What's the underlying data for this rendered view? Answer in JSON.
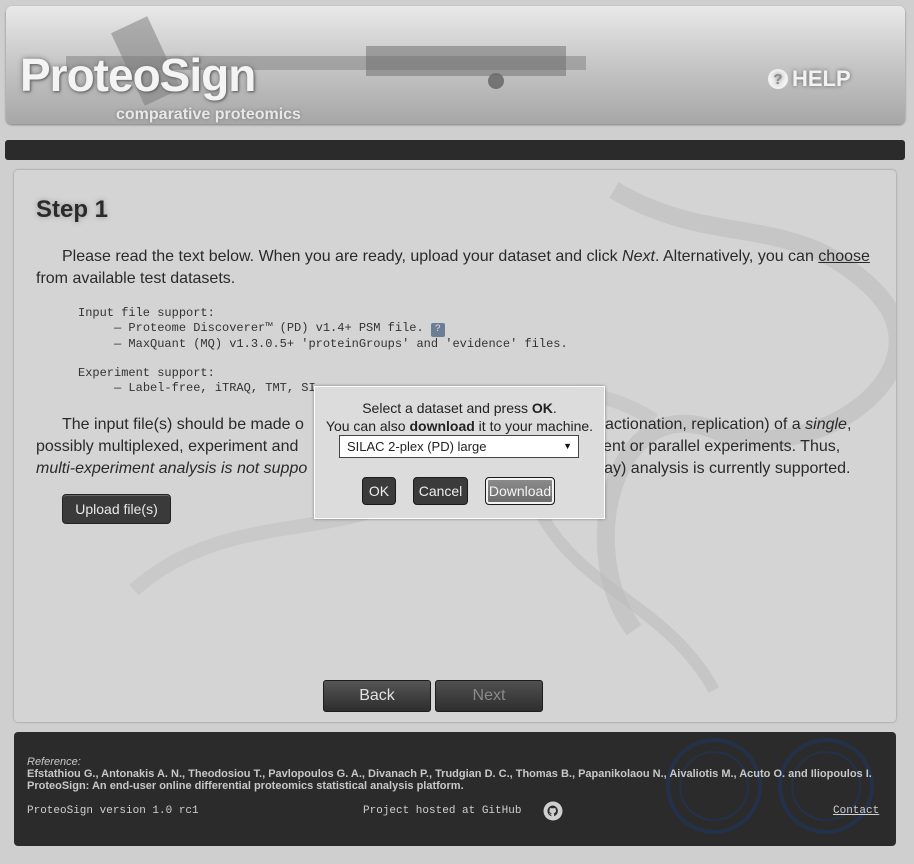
{
  "header": {
    "logo": "ProteoSign",
    "subtitle": "comparative proteomics",
    "help_label": "HELP",
    "help_icon": "question-circle-icon"
  },
  "step": {
    "title": "Step 1",
    "intro_before": "Please read the text below. When you are ready, upload your dataset and click ",
    "intro_next": "Next",
    "intro_middle": ". Alternatively, you can ",
    "intro_link": "choose",
    "intro_after": " from available test datasets.",
    "input_support_heading": "Input file support:",
    "input_support_item1": "— Proteome Discoverer™ (PD) v1.4+ PSM file.",
    "input_support_item1_help": "?",
    "input_support_item2": "— MaxQuant (MQ) v1.3.0.5+ 'proteinGroups' and 'evidence' files.",
    "experiment_support_heading": "Experiment support:",
    "experiment_support_item1": "— Label-free, iTRAQ, TMT, SI",
    "p2_part1": "The input file(s) should be made o",
    "p2_part1b": "(fractionation, replication) of a ",
    "p2_single": "single",
    "p2_part2": ", possibly multiplexed, experiment and ",
    "p2_part2b": "erent or parallel experiments. Thus,",
    "p2_italic": "multi-experiment analysis is not suppo",
    "p2_part3": "-way) analysis is currently supported.",
    "upload_label": "Upload file(s)",
    "back_label": "Back",
    "next_label": "Next"
  },
  "dialog": {
    "line1_prefix": "Select a dataset and press ",
    "line1_bold": "OK",
    "line1_suffix": ".",
    "line2_prefix": "You can also ",
    "line2_bold": "download",
    "line2_suffix": " it to your machine.",
    "selected_dataset": "SILAC 2-plex (PD) large",
    "ok_label": "OK",
    "cancel_label": "Cancel",
    "download_label": "Download"
  },
  "footer": {
    "reference_label": "Reference:",
    "reference_authors": "Efstathiou G., Antonakis A. N., Theodosiou T., Pavlopoulos G. A., Divanach P., Trudgian D. C., Thomas B., Papanikolaou N., Aivaliotis M., Acuto O. and Iliopoulos I.",
    "reference_title": "ProteoSign: An end-user online differential proteomics statistical analysis platform.",
    "version": "ProteoSign version 1.0 rc1",
    "hosted": "Project hosted at GitHub",
    "contact": "Contact"
  }
}
